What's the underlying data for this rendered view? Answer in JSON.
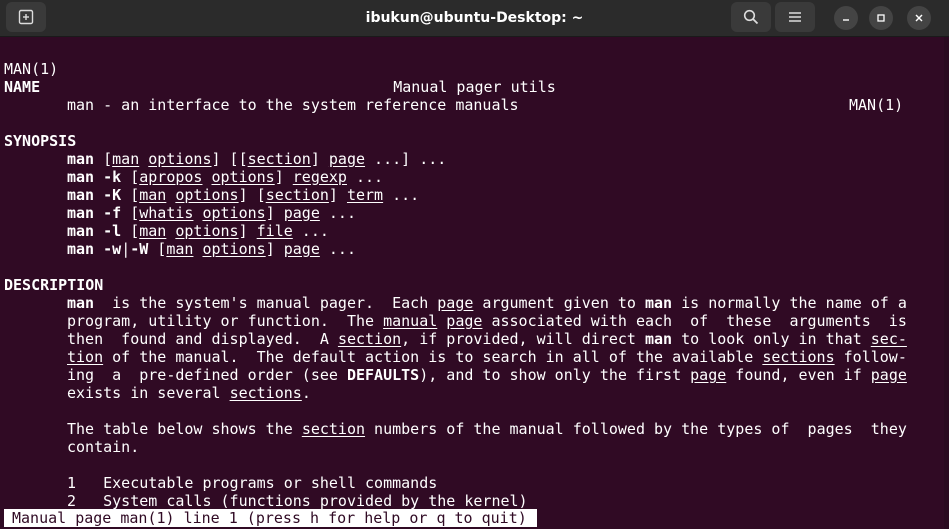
{
  "window": {
    "title": "ibukun@ubuntu-Desktop: ~"
  },
  "icons": [
    "new-tab-icon",
    "search-icon",
    "menu-icon",
    "minimize-icon",
    "maximize-icon",
    "close-icon"
  ],
  "colors": {
    "terminal_bg": "#300a24",
    "titlebar_bg": "#2b2b2b",
    "text": "#ffffff",
    "status_bg": "#ffffff",
    "status_fg": "#300a24"
  },
  "man": {
    "header_left": "MAN(1)",
    "header_center": "Manual pager utils",
    "header_right": "MAN(1)",
    "name_heading": "NAME",
    "name_line": "man - an interface to the system reference manuals",
    "synopsis_heading": "SYNOPSIS",
    "synopsis": [
      [
        "man",
        " ",
        "[",
        "man",
        " ",
        "options",
        "] [[",
        "section",
        "] ",
        "page",
        " ...] ..."
      ],
      [
        "man -k",
        " ",
        "[",
        "apropos",
        " ",
        "options",
        "] ",
        "regexp",
        " ..."
      ],
      [
        "man -K",
        " ",
        "[",
        "man",
        " ",
        "options",
        "] [",
        "section",
        "] ",
        "term",
        " ..."
      ],
      [
        "man -f",
        " ",
        "[",
        "whatis",
        " ",
        "options",
        "] ",
        "page",
        " ..."
      ],
      [
        "man -l",
        " ",
        "[",
        "man",
        " ",
        "options",
        "] ",
        "file",
        " ..."
      ],
      [
        "man -w",
        "|",
        "-W",
        " [",
        "man",
        " ",
        "options",
        "] ",
        "page",
        " ..."
      ]
    ],
    "description_heading": "DESCRIPTION",
    "desc": {
      "l1": [
        "man",
        "  is the system's manual pager.  Each ",
        "page",
        " argument given to ",
        "man",
        " is normally the name of a"
      ],
      "l2": [
        "program, utility or function.  The ",
        "manual",
        " ",
        "page",
        " associated with each  of  these  arguments  is"
      ],
      "l3": [
        "then  found and displayed.  A ",
        "section",
        ", if provided, will direct ",
        "man",
        " to look only in that ",
        "sec-"
      ],
      "l4": [
        "tion",
        " of the manual.  The default action is to search in all of the available ",
        "sections",
        " follow-"
      ],
      "l5": [
        "ing  a  pre-defined order (see ",
        "DEFAULTS",
        "), and to show only the first ",
        "page",
        " found, even if ",
        "page"
      ],
      "l6": [
        "exists in several ",
        "sections",
        "."
      ],
      "p2l1": [
        "The table below shows the ",
        "section",
        " numbers of the manual followed by the types of  pages  they"
      ],
      "p2l2": "contain.",
      "list": [
        {
          "num": "1",
          "text": "Executable programs or shell commands"
        },
        {
          "num": "2",
          "text": "System calls (functions provided by the kernel)"
        }
      ]
    }
  },
  "status": {
    "text": "Manual page man(1) line 1 (press h for help or q to quit)"
  }
}
